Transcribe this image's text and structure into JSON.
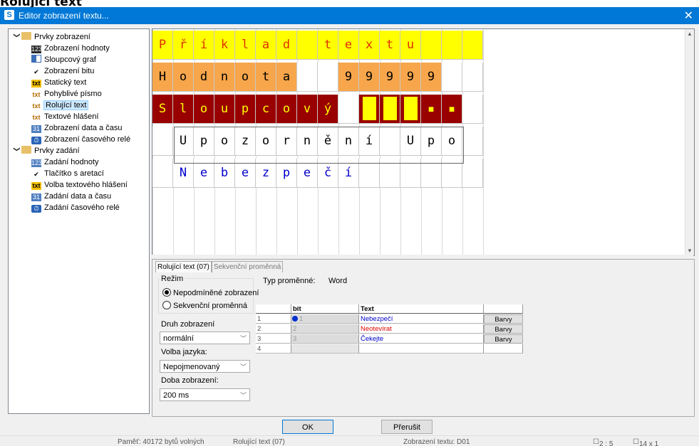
{
  "heading": "Rolující text",
  "window": {
    "title": "Editor zobrazení textu...",
    "icon": "app-s-icon",
    "close_glyph": "✕"
  },
  "tree": {
    "groups": [
      {
        "label": "Prvky zobrazení",
        "expanded": true,
        "items": [
          {
            "label": "Zobrazení hodnoty",
            "icon": "value-display-icon"
          },
          {
            "label": "Sloupcový graf",
            "icon": "bar-graph-icon"
          },
          {
            "label": "Zobrazení bitu",
            "icon": "checkmark-icon"
          },
          {
            "label": "Statický text",
            "icon": "static-text-icon"
          },
          {
            "label": "Pohyblivé písmo",
            "icon": "moving-text-icon"
          },
          {
            "label": "Rolující text",
            "icon": "scrolling-text-icon",
            "selected": true
          },
          {
            "label": "Textové hlášení",
            "icon": "text-message-icon"
          },
          {
            "label": "Zobrazení data a času",
            "icon": "calendar-icon"
          },
          {
            "label": "Zobrazení časového relé",
            "icon": "timer-relay-icon"
          }
        ]
      },
      {
        "label": "Prvky zadání",
        "expanded": true,
        "items": [
          {
            "label": "Zadání hodnoty",
            "icon": "value-input-icon"
          },
          {
            "label": "Tlačítko s aretací",
            "icon": "latch-button-icon"
          },
          {
            "label": "Volba textového hlášení",
            "icon": "message-select-icon"
          },
          {
            "label": "Zadání data a času",
            "icon": "calendar-input-icon"
          },
          {
            "label": "Zadání časového relé",
            "icon": "timer-input-icon"
          }
        ]
      }
    ]
  },
  "preview": {
    "rows": [
      {
        "chars": [
          "P",
          "ř",
          "í",
          "k",
          "l",
          "a",
          "d",
          " ",
          "t",
          "e",
          "x",
          "t",
          "u",
          " ",
          " ",
          " "
        ],
        "bg": "#ffff00",
        "fg": "#e03000"
      },
      {
        "chars": [
          "H",
          "o",
          "d",
          "n",
          "o",
          "t",
          "a",
          " ",
          " ",
          "9",
          "9",
          "9",
          "9",
          "9",
          " ",
          " "
        ],
        "bg": "#f7a64b",
        "fg": "#000000"
      },
      {
        "chars": [
          "S",
          "l",
          "o",
          "u",
          "p",
          "c",
          "o",
          "v",
          "ý",
          " ",
          " ",
          " ",
          " ",
          "▪",
          "▪",
          " "
        ],
        "bg": "#990000",
        "fg": "#ffff00"
      },
      {
        "chars": [
          " ",
          "U",
          "p",
          "o",
          "z",
          "o",
          "r",
          "n",
          "ě",
          "n",
          "í",
          " ",
          "U",
          "p",
          "o",
          " "
        ],
        "bg": "#ffffff",
        "fg": "#000000"
      },
      {
        "chars": [
          " ",
          "N",
          "e",
          "b",
          "e",
          "z",
          "p",
          "e",
          "č",
          "í",
          " ",
          " ",
          " ",
          " ",
          " ",
          " "
        ],
        "bg": "#ffffff",
        "fg": "#0000cc"
      }
    ],
    "bar_levels": [
      1,
      1,
      1
    ]
  },
  "panel": {
    "tabs": [
      "Rolující text (07)",
      "Sekvenční proměnná"
    ],
    "mode_label": "Režim",
    "modes": [
      {
        "label": "Nepodmíněné zobrazení",
        "checked": true
      },
      {
        "label": "Sekvenční proměnná",
        "checked": false
      }
    ],
    "var_type_label": "Typ proměnné:",
    "var_type_value": "Word",
    "display_type_label": "Druh zobrazení",
    "display_type_value": "normální",
    "language_label": "Volba jazyka:",
    "language_value": "Nepojmenovaný",
    "duration_label": "Doba zobrazení:",
    "duration_value": "200 ms",
    "table": {
      "headers": [
        "",
        "bit",
        "Text",
        ""
      ],
      "rows": [
        {
          "num": "1",
          "bit": "1",
          "text": "Nebezpečí",
          "color": "#0000cc",
          "button": "Barvy",
          "marker": true
        },
        {
          "num": "2",
          "bit": "2",
          "text": "Neotevírat",
          "color": "#e00000",
          "button": "Barvy",
          "marker": false
        },
        {
          "num": "3",
          "bit": "3",
          "text": "Čekejte",
          "color": "#0000cc",
          "button": "Barvy",
          "marker": false
        },
        {
          "num": "4",
          "bit": "",
          "text": "",
          "color": "#000000",
          "button": "",
          "marker": false
        }
      ]
    }
  },
  "buttons": {
    "ok": "OK",
    "cancel": "Přerušit"
  },
  "status": {
    "memory": "Paměť: 40172 bytů volných",
    "element": "Rolující text (07)",
    "display": "Zobrazení textu: D01",
    "coords": "2 : 5",
    "size": "14 x 1"
  }
}
